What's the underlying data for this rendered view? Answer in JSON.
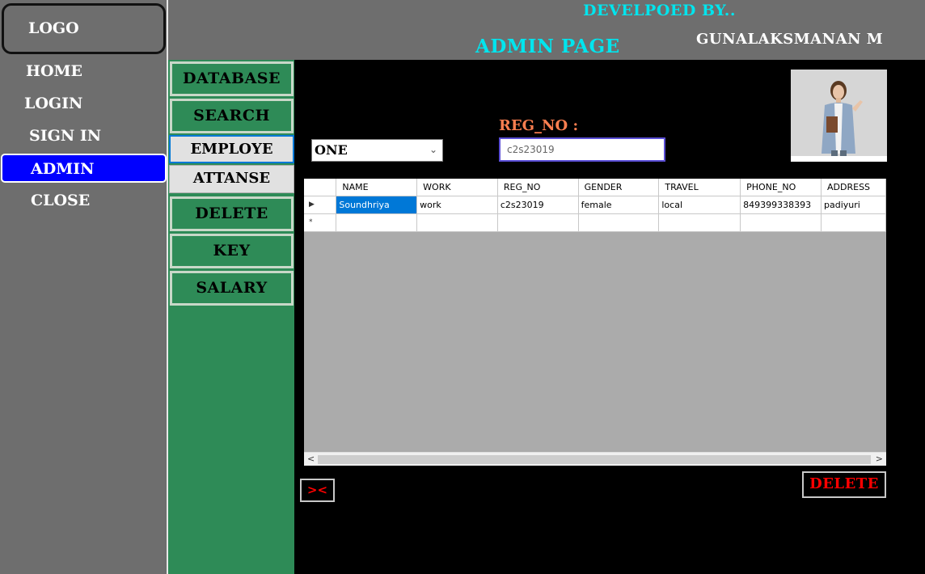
{
  "nav": {
    "logo": "LOGO",
    "items": [
      "HOME",
      "LOGIN",
      "SIGN IN",
      "ADMIN",
      "CLOSE"
    ],
    "active": "ADMIN"
  },
  "header": {
    "developed_by": "DEVELPOED BY..",
    "title": "ADMIN PAGE",
    "developer": "GUNALAKSMANAN M"
  },
  "sidebar": {
    "buttons": [
      "DATABASE",
      "SEARCH",
      "EMPLOYE",
      "ATTANSE",
      "DELETE",
      "KEY",
      "SALARY"
    ]
  },
  "form": {
    "reg_label": "REG_NO  :",
    "combo_value": "ONE",
    "reg_value": "c2s23019"
  },
  "grid": {
    "columns": [
      "NAME",
      "WORK",
      "REG_NO",
      "GENDER",
      "TRAVEL",
      "PHONE_NO",
      "ADDRESS"
    ],
    "rows": [
      [
        "Soundhriya",
        "work",
        "c2s23019",
        "female",
        "local",
        "849399338393",
        "padiyuri"
      ]
    ],
    "new_row_marker": "*"
  },
  "actions": {
    "swap_label": "><",
    "delete_label": "DELETE"
  },
  "colors": {
    "accent_cyan": "#00e5ee",
    "green": "#2e8b57",
    "active_blue": "#0000ff",
    "delete_red": "#ff0000"
  }
}
